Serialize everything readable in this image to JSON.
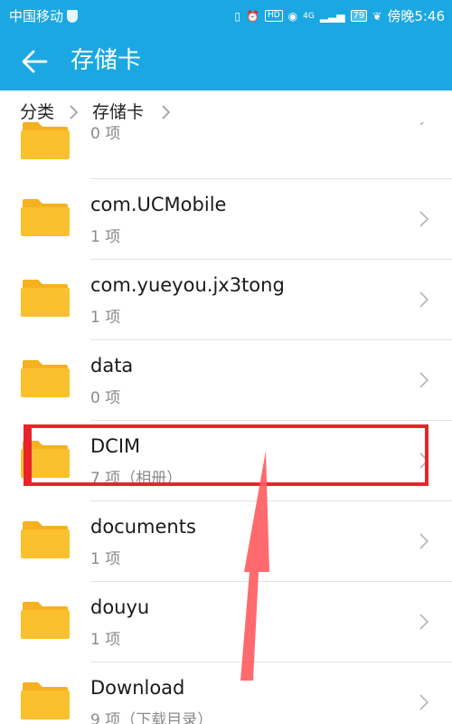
{
  "status_bar": {
    "carrier": "中国移动",
    "network": "4G",
    "hd": "HD",
    "battery": "79",
    "time": "傍晚5:46"
  },
  "app_bar": {
    "title": "存储卡",
    "back_icon": "arrow-left-icon"
  },
  "breadcrumb": {
    "items": [
      "分类",
      "存储卡"
    ]
  },
  "list": {
    "items": [
      {
        "name": ". .",
        "count": "0 项"
      },
      {
        "name": "com.UCMobile",
        "count": "1 项"
      },
      {
        "name": "com.yueyou.jx3tong",
        "count": "1 项"
      },
      {
        "name": "data",
        "count": "0 项"
      },
      {
        "name": "DCIM",
        "count": "7 项（相册）"
      },
      {
        "name": "documents",
        "count": "1 项"
      },
      {
        "name": "douyu",
        "count": "1 项"
      },
      {
        "name": "Download",
        "count": "9 项（下载目录）"
      }
    ]
  },
  "colors": {
    "accent": "#1ba8e2",
    "folder": "#fbc02d",
    "annotation": "#e8242b"
  }
}
